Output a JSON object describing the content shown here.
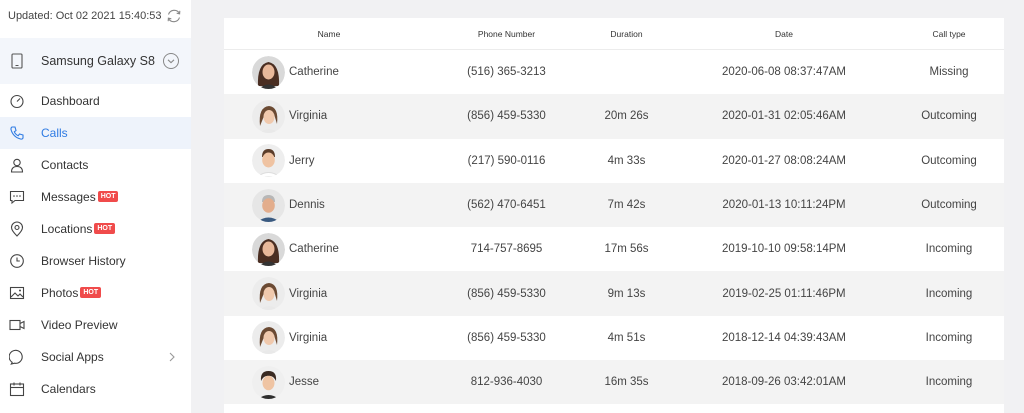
{
  "sidebar": {
    "updated_text": "Updated: Oct 02 2021 15:40:53",
    "device_name": "Samsung Galaxy S8",
    "hot_label": "HOT",
    "items": [
      {
        "label": "Dashboard",
        "icon": "dashboard-icon"
      },
      {
        "label": "Calls",
        "icon": "phone-icon",
        "active": true
      },
      {
        "label": "Contacts",
        "icon": "contact-icon"
      },
      {
        "label": "Messages",
        "icon": "message-icon",
        "hot": true
      },
      {
        "label": "Locations",
        "icon": "location-pin-icon",
        "hot": true
      },
      {
        "label": "Browser History",
        "icon": "clock-icon"
      },
      {
        "label": "Photos",
        "icon": "image-icon",
        "hot": true
      },
      {
        "label": "Video Preview",
        "icon": "video-icon"
      },
      {
        "label": "Social Apps",
        "icon": "chat-bubble-icon",
        "has_arrow": true
      },
      {
        "label": "Calendars",
        "icon": "calendar-icon"
      }
    ]
  },
  "table": {
    "headers": {
      "name": "Name",
      "phone": "Phone Number",
      "duration": "Duration",
      "date": "Date",
      "type": "Call type"
    },
    "rows": [
      {
        "name": "Catherine",
        "phone": "(516) 365-3213",
        "duration": "",
        "date": "2020-06-08 08:37:47AM",
        "type": "Missing",
        "avatar": "catherine"
      },
      {
        "name": "Virginia",
        "phone": "(856) 459-5330",
        "duration": "20m 26s",
        "date": "2020-01-31 02:05:46AM",
        "type": "Outcoming",
        "avatar": "virginia"
      },
      {
        "name": "Jerry",
        "phone": "(217) 590-0116",
        "duration": "4m 33s",
        "date": "2020-01-27 08:08:24AM",
        "type": "Outcoming",
        "avatar": "jerry"
      },
      {
        "name": "Dennis",
        "phone": "(562) 470-6451",
        "duration": "7m 42s",
        "date": "2020-01-13 10:11:24PM",
        "type": "Outcoming",
        "avatar": "dennis"
      },
      {
        "name": "Catherine",
        "phone": "714-757-8695",
        "duration": "17m 56s",
        "date": "2019-10-10 09:58:14PM",
        "type": "Incoming",
        "avatar": "catherine"
      },
      {
        "name": "Virginia",
        "phone": "(856) 459-5330",
        "duration": "9m 13s",
        "date": "2019-02-25 01:11:46PM",
        "type": "Incoming",
        "avatar": "virginia"
      },
      {
        "name": "Virginia",
        "phone": "(856) 459-5330",
        "duration": "4m 51s",
        "date": "2018-12-14 04:39:43AM",
        "type": "Incoming",
        "avatar": "virginia"
      },
      {
        "name": "Jesse",
        "phone": "812-936-4030",
        "duration": "16m 35s",
        "date": "2018-09-26 03:42:01AM",
        "type": "Incoming",
        "avatar": "jesse"
      }
    ]
  },
  "colors": {
    "accent": "#2f7be3",
    "hot": "#f04b4b",
    "active_bg": "#eef3fb"
  }
}
